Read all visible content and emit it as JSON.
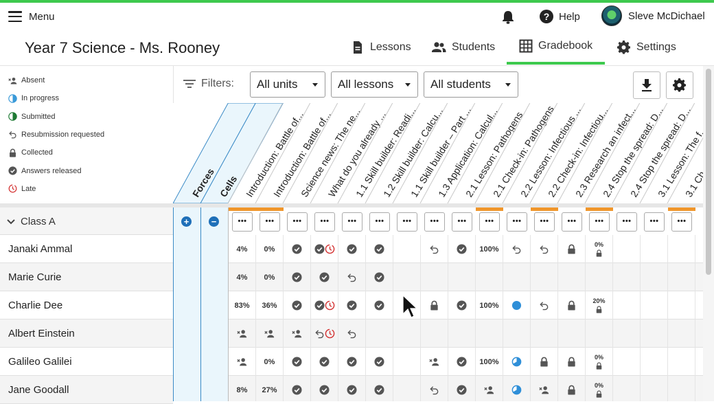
{
  "topbar": {
    "menu_label": "Menu",
    "help_label": "Help",
    "user_name": "Sleve McDichael"
  },
  "header": {
    "title": "Year 7 Science - Ms. Rooney",
    "tabs": [
      {
        "label": "Lessons",
        "icon": "document-icon"
      },
      {
        "label": "Students",
        "icon": "people-icon"
      },
      {
        "label": "Gradebook",
        "icon": "grid-icon",
        "active": true
      },
      {
        "label": "Settings",
        "icon": "gear-icon"
      }
    ]
  },
  "legend": [
    {
      "label": "Absent",
      "icon": "absent"
    },
    {
      "label": "In progress",
      "icon": "inprogress"
    },
    {
      "label": "Submitted",
      "icon": "submitted"
    },
    {
      "label": "Resubmission requested",
      "icon": "resub"
    },
    {
      "label": "Collected",
      "icon": "lock"
    },
    {
      "label": "Answers released",
      "icon": "check"
    },
    {
      "label": "Late",
      "icon": "late"
    }
  ],
  "filters": {
    "label": "Filters:",
    "units": "All units",
    "lessons": "All lessons",
    "students": "All students"
  },
  "groups": [
    "Forces",
    "Cells"
  ],
  "columns": [
    "Introduction: Battle of...",
    "Introduction: Battle of...",
    "Science news: The ne...",
    "What do you already ...",
    "1.1 Skill builder: Readi...",
    "1.2 Skill builder: Calcu...",
    "1.1 Skill builder – Part ...",
    "1.3 Application: Calcul...",
    "2.1 Lesson: Pathogens",
    "2.1 Check-in: Pathogens",
    "2.2 Lesson: Infectious ...",
    "2.2 Check-in: Infectiou...",
    "2.3 Research an infect...",
    "2.4 Stop the spread: D...",
    "2.4 Stop the spread: D...",
    "3.1 Lesson: The f...",
    "3.1 Ch"
  ],
  "orange_columns": [
    0,
    1,
    9,
    11,
    13,
    16
  ],
  "action_label": "•••",
  "class_name": "Class A",
  "students": [
    {
      "name": "Janaki Ammal",
      "cells": [
        "4%",
        "0%",
        "check",
        "check-late",
        "check",
        "check",
        "",
        "resub",
        "check",
        "100%",
        "resub",
        "resub",
        "lock",
        "0%|lock",
        "",
        "",
        ""
      ]
    },
    {
      "name": "Marie Curie",
      "cells": [
        "4%",
        "0%",
        "check",
        "check",
        "resub",
        "check",
        "",
        "",
        "",
        "",
        "",
        "",
        "",
        "",
        "",
        "",
        ""
      ]
    },
    {
      "name": "Charlie Dee",
      "cells": [
        "83%",
        "36%",
        "check",
        "check-late",
        "check",
        "check",
        "",
        "lock",
        "check",
        "100%",
        "inprog-dot",
        "resub",
        "lock",
        "20%|lock",
        "",
        "",
        ""
      ]
    },
    {
      "name": "Albert Einstein",
      "cells": [
        "absent",
        "absent",
        "absent",
        "resub-late",
        "resub",
        "",
        "",
        "",
        "",
        "",
        "",
        "",
        "",
        "",
        "",
        "",
        ""
      ]
    },
    {
      "name": "Galileo Galilei",
      "cells": [
        "absent",
        "0%",
        "check",
        "check",
        "check",
        "check",
        "",
        "absent",
        "check",
        "100%",
        "inprog-pie",
        "lock",
        "lock",
        "0%|lock",
        "",
        "",
        ""
      ]
    },
    {
      "name": "Jane Goodall",
      "cells": [
        "8%",
        "27%",
        "check",
        "check",
        "check",
        "check",
        "",
        "resub",
        "check",
        "absent",
        "inprog-pie",
        "absent",
        "lock",
        "0%|lock",
        "",
        "",
        ""
      ]
    }
  ]
}
